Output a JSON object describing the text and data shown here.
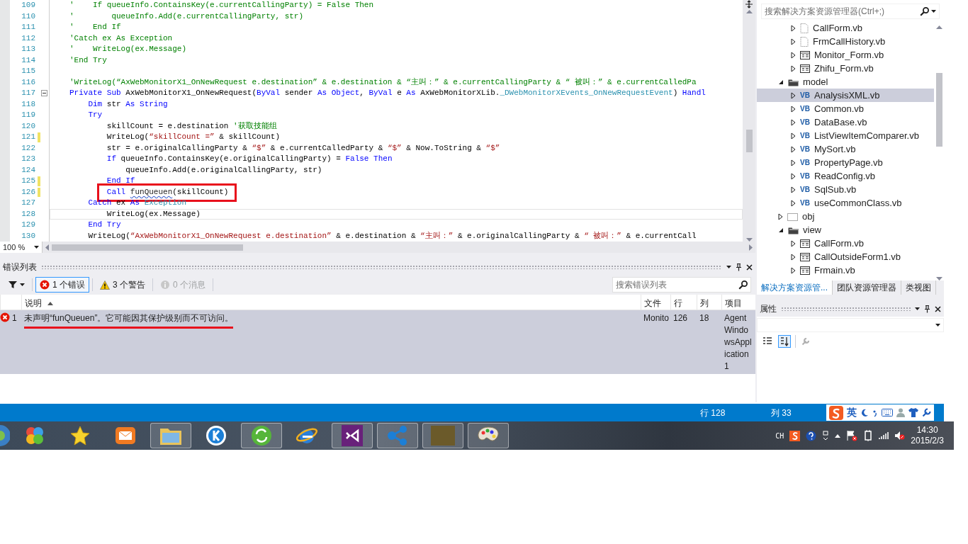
{
  "editor": {
    "lines": [
      {
        "number": "109",
        "changed": false,
        "foldable": false,
        "current": false,
        "annotated": false,
        "tokens": [
          {
            "kind": "comment",
            "text": "'    If queueInfo.ContainsKey(e.currentCallingParty) = False Then"
          }
        ]
      },
      {
        "number": "110",
        "changed": false,
        "foldable": false,
        "current": false,
        "annotated": false,
        "tokens": [
          {
            "kind": "comment",
            "text": "'        queueInfo.Add(e.currentCallingParty, str)"
          }
        ]
      },
      {
        "number": "111",
        "changed": false,
        "foldable": false,
        "current": false,
        "annotated": false,
        "tokens": [
          {
            "kind": "comment",
            "text": "'    End If"
          }
        ]
      },
      {
        "number": "112",
        "changed": false,
        "foldable": false,
        "current": false,
        "annotated": false,
        "tokens": [
          {
            "kind": "comment",
            "text": "'Catch ex As Exception"
          }
        ]
      },
      {
        "number": "113",
        "changed": false,
        "foldable": false,
        "current": false,
        "annotated": false,
        "tokens": [
          {
            "kind": "comment",
            "text": "'    WriteLog(ex.Message)"
          }
        ]
      },
      {
        "number": "114",
        "changed": false,
        "foldable": false,
        "current": false,
        "annotated": false,
        "tokens": [
          {
            "kind": "comment",
            "text": "'End Try"
          }
        ]
      },
      {
        "number": "115",
        "changed": false,
        "foldable": false,
        "current": false,
        "annotated": false
      },
      {
        "number": "116",
        "changed": false,
        "foldable": false,
        "current": false,
        "annotated": false,
        "tokens": [
          {
            "kind": "comment",
            "text": "'WriteLog(“AxWebMonitorX1_OnNewRequest e.destination” & e.destination & “主叫：” & e.currentCallingParty & “ 被叫：” & e.currentCalledPa"
          }
        ]
      },
      {
        "number": "117",
        "changed": false,
        "foldable": true,
        "current": false,
        "annotated": false,
        "tokens": [
          {
            "kind": "keyword",
            "text": "Private Sub"
          },
          {
            "kind": "plain",
            "text": " AxWebMonitorX1_OnNewRequest("
          },
          {
            "kind": "keyword",
            "text": "ByVal"
          },
          {
            "kind": "plain",
            "text": " sender "
          },
          {
            "kind": "keyword",
            "text": "As Object"
          },
          {
            "kind": "plain",
            "text": ", "
          },
          {
            "kind": "keyword",
            "text": "ByVal"
          },
          {
            "kind": "plain",
            "text": " e "
          },
          {
            "kind": "keyword",
            "text": "As"
          },
          {
            "kind": "plain",
            "text": " AxWebMonitorXLib."
          },
          {
            "kind": "type",
            "text": "_DWebMonitorXEvents_OnNewRequestEvent"
          },
          {
            "kind": "plain",
            "text": ") "
          },
          {
            "kind": "keyword",
            "text": "Handl"
          }
        ]
      },
      {
        "number": "118",
        "changed": false,
        "foldable": false,
        "current": false,
        "annotated": false,
        "tokens": [
          {
            "kind": "keyword",
            "text": "    Dim"
          },
          {
            "kind": "plain",
            "text": " str "
          },
          {
            "kind": "keyword",
            "text": "As String"
          }
        ]
      },
      {
        "number": "119",
        "changed": false,
        "foldable": false,
        "current": false,
        "annotated": false,
        "tokens": [
          {
            "kind": "keyword",
            "text": "    Try"
          }
        ]
      },
      {
        "number": "120",
        "changed": false,
        "foldable": false,
        "current": false,
        "annotated": false,
        "tokens": [
          {
            "kind": "plain",
            "text": "        skillCount = e.destination "
          },
          {
            "kind": "comment",
            "text": "'获取技能组"
          }
        ]
      },
      {
        "number": "121",
        "changed": true,
        "foldable": false,
        "current": false,
        "annotated": false,
        "tokens": [
          {
            "kind": "plain",
            "text": "        WriteLog("
          },
          {
            "kind": "string",
            "text": "“skillCount =”"
          },
          {
            "kind": "plain",
            "text": " & skillCount)"
          }
        ]
      },
      {
        "number": "122",
        "changed": false,
        "foldable": false,
        "current": false,
        "annotated": false,
        "tokens": [
          {
            "kind": "plain",
            "text": "        str = e.originalCallingParty & "
          },
          {
            "kind": "string",
            "text": "“$”"
          },
          {
            "kind": "plain",
            "text": " & e.currentCalledParty & "
          },
          {
            "kind": "string",
            "text": "“$”"
          },
          {
            "kind": "plain",
            "text": " & Now.ToString & "
          },
          {
            "kind": "string",
            "text": "“$”"
          }
        ]
      },
      {
        "number": "123",
        "changed": false,
        "foldable": false,
        "current": false,
        "annotated": false,
        "tokens": [
          {
            "kind": "keyword",
            "text": "        If"
          },
          {
            "kind": "plain",
            "text": " queueInfo.ContainsKey(e.originalCallingParty) = "
          },
          {
            "kind": "keyword",
            "text": "False Then"
          }
        ]
      },
      {
        "number": "124",
        "changed": false,
        "foldable": false,
        "current": false,
        "annotated": false,
        "tokens": [
          {
            "kind": "plain",
            "text": "            queueInfo.Add(e.originalCallingParty, str)"
          }
        ]
      },
      {
        "number": "125",
        "changed": true,
        "foldable": false,
        "current": false,
        "annotated": false,
        "tokens": [
          {
            "kind": "keyword",
            "text": "        End If"
          }
        ]
      },
      {
        "number": "126",
        "changed": true,
        "foldable": false,
        "current": false,
        "annotated": true,
        "tokens": [
          {
            "kind": "keyword",
            "text": "        Call "
          },
          {
            "kind": "error",
            "text": "funQueuen"
          },
          {
            "kind": "plain",
            "text": "(skillCount)"
          }
        ]
      },
      {
        "number": "127",
        "changed": false,
        "foldable": false,
        "current": false,
        "annotated": false,
        "tokens": [
          {
            "kind": "keyword",
            "text": "    Catch"
          },
          {
            "kind": "plain",
            "text": " ex "
          },
          {
            "kind": "keyword",
            "text": "As "
          },
          {
            "kind": "type",
            "text": "Exception"
          }
        ]
      },
      {
        "number": "128",
        "changed": false,
        "foldable": false,
        "current": true,
        "annotated": false,
        "tokens": [
          {
            "kind": "plain",
            "text": "        WriteLog(ex.Message)"
          }
        ]
      },
      {
        "number": "129",
        "changed": false,
        "foldable": false,
        "current": false,
        "annotated": false,
        "tokens": [
          {
            "kind": "keyword",
            "text": "    End Try"
          }
        ]
      },
      {
        "number": "130",
        "changed": false,
        "foldable": false,
        "current": false,
        "annotated": false,
        "tokens": [
          {
            "kind": "plain",
            "text": "    WriteLog("
          },
          {
            "kind": "string",
            "text": "“AxWebMonitorX1_OnNewRequest e.destination”"
          },
          {
            "kind": "plain",
            "text": " & e.destination & "
          },
          {
            "kind": "string",
            "text": "“主叫：”"
          },
          {
            "kind": "plain",
            "text": " & e.originalCallingParty & "
          },
          {
            "kind": "string",
            "text": "“ 被叫：”"
          },
          {
            "kind": "plain",
            "text": " & e.currentCall"
          }
        ]
      }
    ],
    "zoom": "100 %"
  },
  "solution_explorer": {
    "search": {
      "placeholder": "搜索解决方案资源管理器(Ctrl+;)"
    },
    "tree": {
      "continued_items": [
        {
          "label": "CallForm.vb",
          "kind": "file",
          "expanded": false,
          "selected": false
        },
        {
          "label": "FrmCallHistory.vb",
          "kind": "file",
          "expanded": false,
          "selected": false
        },
        {
          "label": "Monitor_Form.vb",
          "kind": "form",
          "expanded": false,
          "selected": false
        },
        {
          "label": "Zhifu_Form.vb",
          "kind": "form",
          "expanded": false,
          "selected": false
        }
      ],
      "items": [
        {
          "label": "model",
          "kind": "folder",
          "expanded": true,
          "selected": false,
          "children": [
            {
              "label": "AnalysisXML.vb",
              "kind": "vb",
              "badge": "VB",
              "expanded": false,
              "selected": true
            },
            {
              "label": "Common.vb",
              "kind": "vb",
              "badge": "VB",
              "expanded": false,
              "selected": false
            },
            {
              "label": "DataBase.vb",
              "kind": "vb",
              "badge": "VB",
              "expanded": false,
              "selected": false
            },
            {
              "label": "ListViewItemComparer.vb",
              "kind": "vb",
              "badge": "VB",
              "expanded": false,
              "selected": false
            },
            {
              "label": "MySort.vb",
              "kind": "vb",
              "badge": "VB",
              "expanded": false,
              "selected": false
            },
            {
              "label": "PropertyPage.vb",
              "kind": "vb",
              "badge": "VB",
              "expanded": false,
              "selected": false
            },
            {
              "label": "ReadConfig.vb",
              "kind": "vb",
              "badge": "VB",
              "expanded": false,
              "selected": false
            },
            {
              "label": "SqlSub.vb",
              "kind": "vb",
              "badge": "VB",
              "expanded": false,
              "selected": false
            },
            {
              "label": "useCommonClass.vb",
              "kind": "vb",
              "badge": "VB",
              "expanded": false,
              "selected": false
            }
          ]
        },
        {
          "label": "obj",
          "kind": "dotted-folder",
          "expanded": false,
          "selected": false
        },
        {
          "label": "view",
          "kind": "folder",
          "expanded": true,
          "selected": false,
          "children": [
            {
              "label": "CallForm.vb",
              "kind": "form",
              "expanded": false,
              "selected": false
            },
            {
              "label": "CallOutsideForm1.vb",
              "kind": "form",
              "expanded": false,
              "selected": false
            },
            {
              "label": "Frmain.vb",
              "kind": "form",
              "expanded": false,
              "selected": false
            }
          ]
        }
      ]
    },
    "tabs": [
      {
        "label": "解决方案资源管...",
        "selected": true
      },
      {
        "label": "团队资源管理器",
        "selected": false
      },
      {
        "label": "类视图",
        "selected": false
      }
    ]
  },
  "error_list": {
    "title": "错误列表",
    "filters": [
      {
        "kind": "error",
        "label": "1 个错误",
        "selected": true,
        "disabled": false
      },
      {
        "kind": "warning",
        "label": "3 个警告",
        "selected": false,
        "disabled": false
      },
      {
        "kind": "message",
        "label": "0 个消息",
        "selected": false,
        "disabled": true
      }
    ],
    "search": {
      "placeholder": "搜索错误列表"
    },
    "columns": [
      {
        "label": "说明",
        "sorted": true
      },
      {
        "label": "文件",
        "sorted": false
      },
      {
        "label": "行",
        "sorted": false
      },
      {
        "label": "列",
        "sorted": false
      },
      {
        "label": "项目",
        "sorted": false
      }
    ],
    "rows": [
      {
        "kind": "error",
        "number": "1",
        "description": "未声明“funQueuen”。它可能因其保护级别而不可访问。",
        "file": "Monito",
        "line": "126",
        "column": "18",
        "project": "AgentWindowsApplication1",
        "selected": true,
        "annotated": true
      }
    ]
  },
  "properties": {
    "title": "属性"
  },
  "status_bar": {
    "line": "行 128",
    "column": "列 33",
    "ime_mode": "英"
  },
  "taskbar": {
    "apps": [
      {
        "kind": "circles",
        "running": false
      },
      {
        "kind": "star",
        "running": false
      },
      {
        "kind": "mail",
        "running": false
      },
      {
        "kind": "folder",
        "running": true
      },
      {
        "kind": "blue-circle",
        "running": false
      },
      {
        "kind": "green-circle",
        "running": true
      },
      {
        "kind": "globe",
        "running": false
      },
      {
        "kind": "vs",
        "running": true
      },
      {
        "kind": "network",
        "running": true
      },
      {
        "kind": "photo",
        "running": true
      },
      {
        "kind": "palette",
        "running": true
      }
    ],
    "language": "CH",
    "time": "14:30",
    "date": "2015/2/3"
  }
}
